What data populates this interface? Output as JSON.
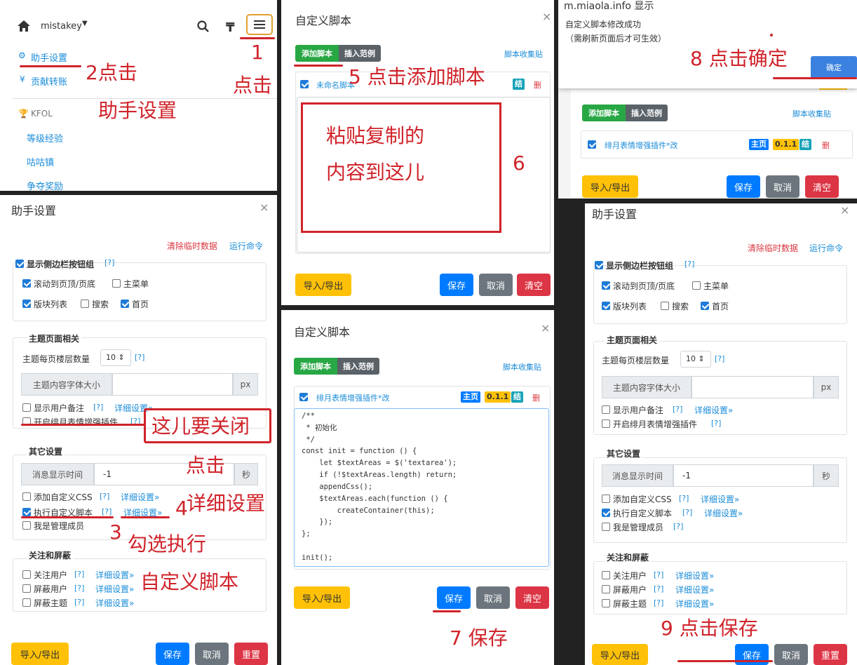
{
  "nav": {
    "user": "mistakey",
    "items": [
      "助手设置",
      "贡献转账"
    ],
    "section": "KFOL",
    "subitems": [
      "等级经验",
      "咕咕镇",
      "争夺奖励"
    ]
  },
  "settings": {
    "title": "助手设置",
    "clear_temp": "清除临时数据",
    "run_cmd": "运行命令",
    "show_sidebar": "显示侧边栏按钮组",
    "help": "[?]",
    "scroll": "滚动到页顶/页底",
    "main_menu": "主菜单",
    "board_list": "版块列表",
    "search": "搜索",
    "home": "首页",
    "topic_section": "主题页面相关",
    "floors_label": "主题每页楼层数量",
    "floors_value": "10 ⇕",
    "font_size_label": "主题内容字体大小",
    "px": "px",
    "show_remark": "显示用户备注",
    "detail": "详细设置»",
    "emoji": "开启绯月表情增强插件",
    "other_section": "其它设置",
    "msg_time_label": "消息显示时间",
    "msg_time_value": "-1",
    "sec": "秒",
    "custom_css": "添加自定义CSS",
    "custom_script": "执行自定义脚本",
    "admin": "我是管理成员",
    "follow_section": "关注和屏蔽",
    "follow_user": "关注用户",
    "block_user": "屏蔽用户",
    "block_topic": "屏蔽主题",
    "import_export": "导入/导出",
    "save": "保存",
    "cancel": "取消",
    "reset": "重置"
  },
  "script_dialog": {
    "title": "自定义脚本",
    "add": "添加脚本",
    "insert": "插入范例",
    "collect": "脚本收集贴",
    "unnamed": "未命名脚本",
    "jie": "结",
    "del": "删",
    "script_name": "绯月表情增强插件*改",
    "main": "主页",
    "version": "0.1.1",
    "import_export": "导入/导出",
    "save": "保存",
    "cancel": "取消",
    "clear": "清空",
    "code": [
      "/**",
      " * 初始化",
      " */",
      "const init = function () {",
      "    let $textAreas = $('textarea');",
      "    if (!$textAreas.length) return;",
      "    appendCss();",
      "    $textAreas.each(function () {",
      "        createContainer(this);",
      "    });",
      "};",
      "",
      "init();"
    ]
  },
  "alert": {
    "domain": "m.miaola.info 显示",
    "msg1": "自定义脚本修改成功",
    "msg2": "（需刷新页面后才可生效）",
    "ok": "确定"
  },
  "annotations": {
    "a1": "1",
    "a1b": "点击",
    "a2": "2点击",
    "a2b": "助手设置",
    "a3": "3",
    "a3b": "勾选执行",
    "a4": "4",
    "a4b": "详细设置",
    "click": "点击",
    "custom": "自定义脚本",
    "close_here": "这儿要关闭",
    "a5": "5 点击添加脚本",
    "a6a": "粘贴复制的",
    "a6b": "内容到这儿",
    "a6": "6",
    "a7": "7 保存",
    "a8": "8 点击确定",
    "a9": "9 点击保存"
  }
}
